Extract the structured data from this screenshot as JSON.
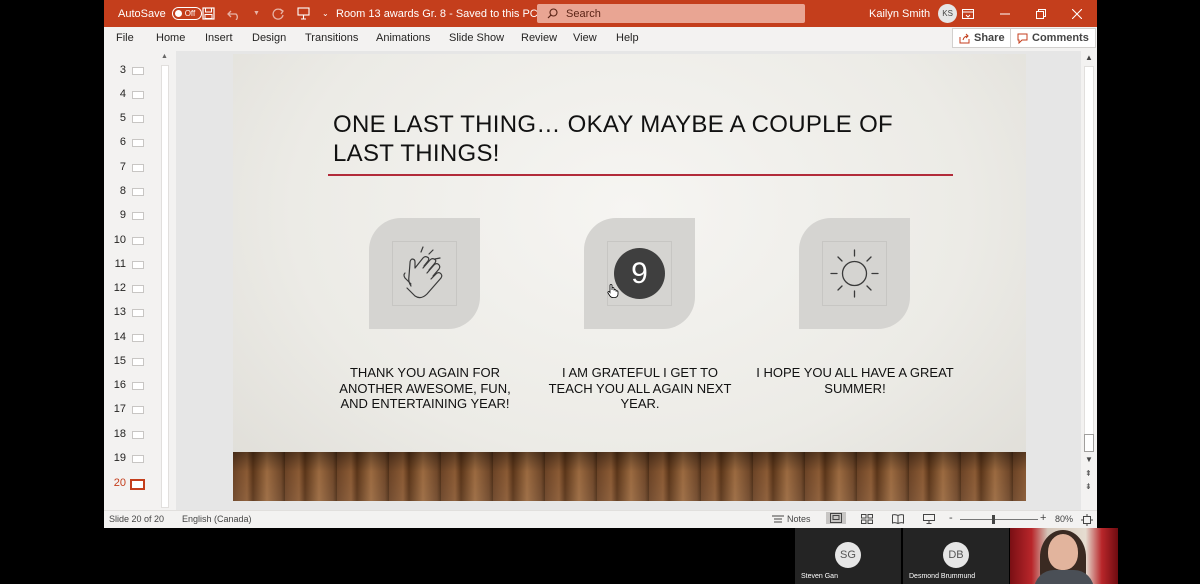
{
  "titlebar": {
    "autosave_label": "AutoSave",
    "autosave_state": "Off",
    "doc_title": "Room 13 awards Gr. 8  -  Saved to this PC",
    "search_placeholder": "Search",
    "user_name": "Kailyn Smith",
    "user_initials": "KS"
  },
  "ribbon": {
    "tabs": [
      "File",
      "Home",
      "Insert",
      "Design",
      "Transitions",
      "Animations",
      "Slide Show",
      "Review",
      "View",
      "Help"
    ],
    "share_label": "Share",
    "comments_label": "Comments"
  },
  "thumbnails": {
    "numbers": [
      "3",
      "4",
      "5",
      "6",
      "7",
      "8",
      "9",
      "10",
      "11",
      "12",
      "13",
      "14",
      "15",
      "16",
      "17",
      "18",
      "19",
      "20"
    ],
    "active": "20"
  },
  "slide": {
    "title": "ONE LAST THING… OKAY MAYBE A COUPLE OF LAST THINGS!",
    "rule_color": "#b22b3a",
    "cards": [
      {
        "icon": "clapping-hands-icon",
        "caption": "THANK YOU AGAIN FOR ANOTHER AWESOME, FUN, AND ENTERTAINING YEAR!"
      },
      {
        "icon": "number-9-icon",
        "number": "9",
        "caption": "I AM GRATEFUL I GET TO TEACH YOU ALL AGAIN NEXT YEAR."
      },
      {
        "icon": "sun-icon",
        "caption": "I HOPE YOU ALL HAVE A GREAT SUMMER!"
      }
    ]
  },
  "statusbar": {
    "slide_info": "Slide 20 of 20",
    "language": "English (Canada)",
    "notes_label": "Notes",
    "zoom_minus": "-",
    "zoom_plus": "+",
    "zoom_level": "80%"
  },
  "participants": [
    {
      "initials": "SG",
      "name": "Steven Gan"
    },
    {
      "initials": "DB",
      "name": "Desmond Brummund"
    }
  ],
  "colors": {
    "accent": "#c43e1c",
    "slide_rule": "#b22b3a"
  }
}
